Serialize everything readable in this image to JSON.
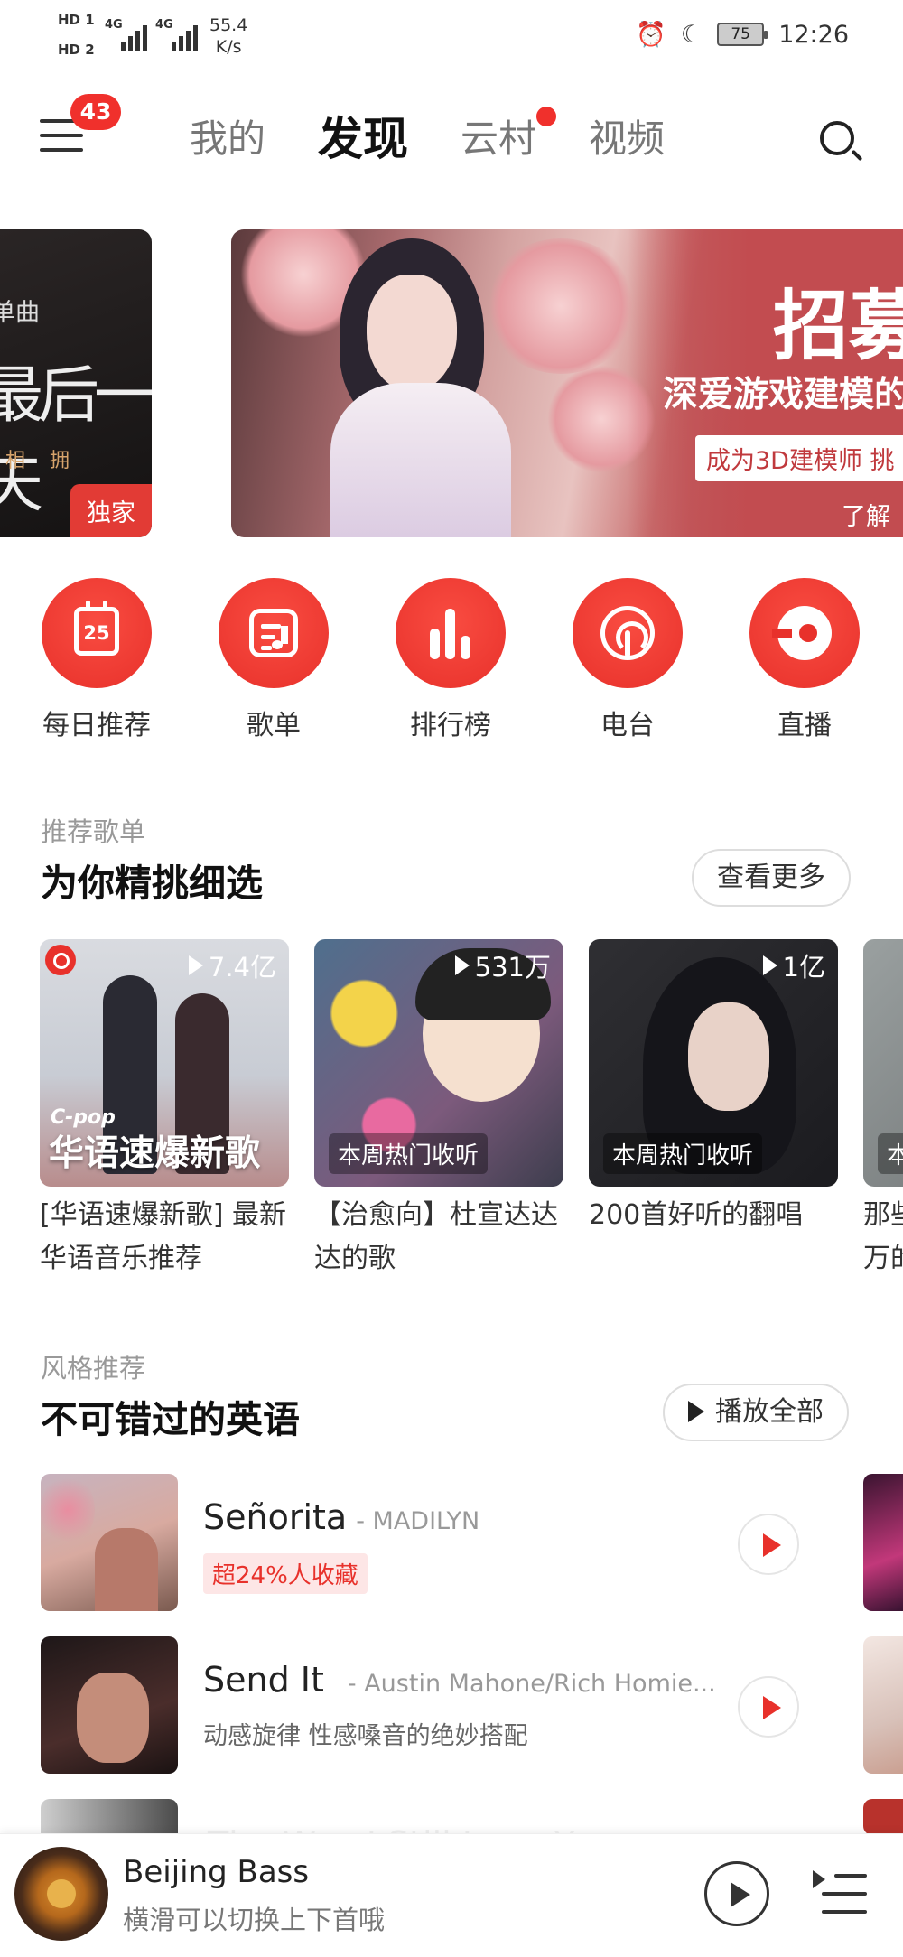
{
  "status_bar": {
    "network": [
      "HD 1",
      "HD 2"
    ],
    "signal_labels": [
      "4G",
      "4G"
    ],
    "speed_value": "55.4",
    "speed_unit": "K/s",
    "battery": "75",
    "time": "12:26"
  },
  "header": {
    "menu_badge": "43",
    "tabs": [
      {
        "label": "我的",
        "active": false
      },
      {
        "label": "发现",
        "active": true
      },
      {
        "label": "云村",
        "active": false,
        "dot": true
      },
      {
        "label": "视频",
        "active": false
      }
    ]
  },
  "banner_left": {
    "line1": "单曲",
    "line2": "最后一天",
    "line3": "相 拥",
    "tag": "独家"
  },
  "banner_main": {
    "headline": "招募",
    "subhead": "深爱游戏建模的",
    "callout": "成为3D建模师 挑",
    "more": "了解"
  },
  "quick_links": [
    {
      "label": "每日推荐",
      "icon": "calendar-icon",
      "day": "25"
    },
    {
      "label": "歌单",
      "icon": "playlist-icon"
    },
    {
      "label": "排行榜",
      "icon": "chart-bars-icon"
    },
    {
      "label": "电台",
      "icon": "radio-icon"
    },
    {
      "label": "直播",
      "icon": "live-icon"
    }
  ],
  "recommended": {
    "subtitle": "推荐歌单",
    "title": "为你精挑细选",
    "more_button": "查看更多",
    "cards": [
      {
        "plays": "7.4亿",
        "cover_tag": "C-pop",
        "cover_text": "华语速爆新歌",
        "title": "[华语速爆新歌] 最新华语音乐推荐"
      },
      {
        "plays": "531万",
        "cover_text": "本周热门收听",
        "title": "【治愈向】杜宣达达达的歌"
      },
      {
        "plays": "1亿",
        "cover_text": "本周热门收听",
        "title": "200首好听的翻唱"
      },
      {
        "plays": "",
        "cover_text": "本",
        "title": "那些万的"
      }
    ]
  },
  "style": {
    "subtitle": "风格推荐",
    "title": "不可错过的英语",
    "play_all": "播放全部",
    "songs": [
      {
        "name": "Señorita",
        "artist": "- MADILYN",
        "tag": "超24%人收藏"
      },
      {
        "name": "Send It",
        "artist": "- Austin Mahone/Rich Homie...",
        "desc": "动感旋律 性感嗓音的绝妙搭配"
      },
      {
        "name": "The Way I Still Love Y..."
      }
    ]
  },
  "player": {
    "title": "Beijing Bass",
    "subtitle": "横滑可以切换上下首哦"
  },
  "colors": {
    "accent": "#e8312b",
    "text": "#222222",
    "muted": "#999999"
  }
}
